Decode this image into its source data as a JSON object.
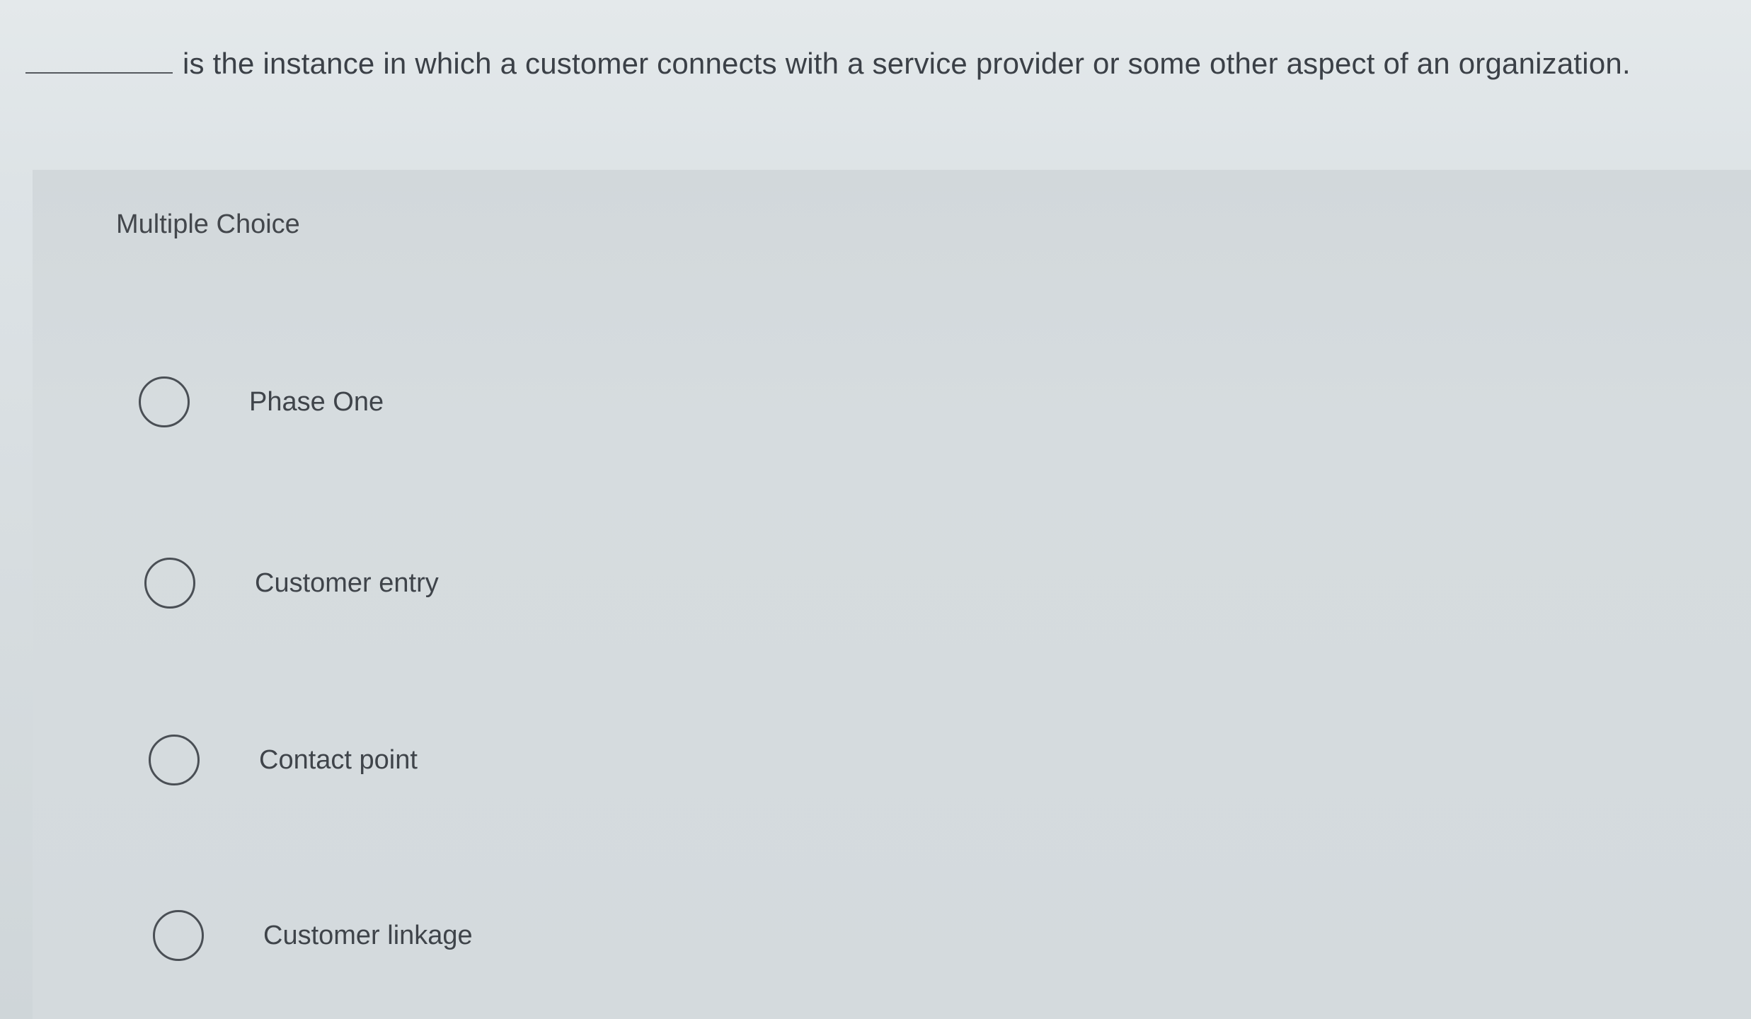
{
  "question": {
    "blank": "_________",
    "text": "is the instance in which a customer connects with a service provider or some other aspect of an organization."
  },
  "answer_panel": {
    "type_label": "Multiple Choice",
    "choices": [
      {
        "label": "Phase One",
        "selected": false
      },
      {
        "label": "Customer entry",
        "selected": false
      },
      {
        "label": "Contact point",
        "selected": false
      },
      {
        "label": "Customer linkage",
        "selected": false
      }
    ]
  }
}
